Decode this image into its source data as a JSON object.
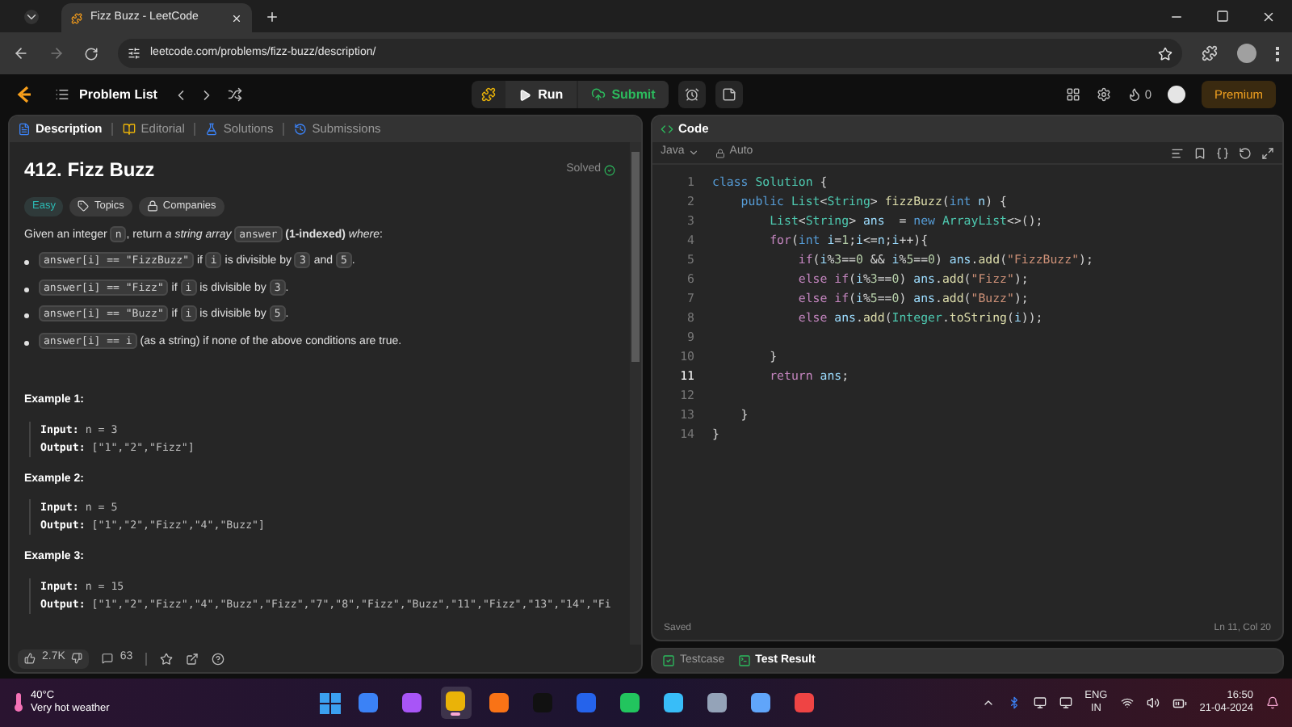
{
  "browser": {
    "tab_title": "Fizz Buzz - LeetCode",
    "url": "leetcode.com/problems/fizz-buzz/description/"
  },
  "nav": {
    "problem_list": "Problem List",
    "run": "Run",
    "submit": "Submit",
    "streak": "0",
    "premium": "Premium"
  },
  "left_tabs": [
    {
      "label": "Description",
      "selected": true
    },
    {
      "label": "Editorial",
      "selected": false
    },
    {
      "label": "Solutions",
      "selected": false
    },
    {
      "label": "Submissions",
      "selected": false
    }
  ],
  "problem": {
    "title": "412. Fizz Buzz",
    "status": "Solved",
    "tags": [
      {
        "kind": "difficulty",
        "label": "Easy"
      },
      {
        "kind": "topics",
        "label": "Topics"
      },
      {
        "kind": "companies",
        "label": "Companies"
      }
    ],
    "statement": [
      {
        "kind": "text",
        "text": "Given an integer "
      },
      {
        "kind": "code",
        "text": "n"
      },
      {
        "kind": "text",
        "text": ", return *a string array* "
      },
      {
        "kind": "code",
        "text": "answer"
      },
      {
        "kind": "text",
        "text": " **(1-indexed)** *where*:"
      }
    ],
    "bullets": [
      [
        {
          "kind": "code",
          "text": "answer[i] == \"FizzBuzz\""
        },
        {
          "kind": "text",
          "text": " if "
        },
        {
          "kind": "code",
          "text": "i"
        },
        {
          "kind": "text",
          "text": " is divisible by "
        },
        {
          "kind": "code",
          "text": "3"
        },
        {
          "kind": "text",
          "text": " and "
        },
        {
          "kind": "code",
          "text": "5"
        },
        {
          "kind": "text",
          "text": "."
        }
      ],
      [
        {
          "kind": "code",
          "text": "answer[i] == \"Fizz\""
        },
        {
          "kind": "text",
          "text": " if "
        },
        {
          "kind": "code",
          "text": "i"
        },
        {
          "kind": "text",
          "text": " is divisible by "
        },
        {
          "kind": "code",
          "text": "3"
        },
        {
          "kind": "text",
          "text": "."
        }
      ],
      [
        {
          "kind": "code",
          "text": "answer[i] == \"Buzz\""
        },
        {
          "kind": "text",
          "text": " if "
        },
        {
          "kind": "code",
          "text": "i"
        },
        {
          "kind": "text",
          "text": " is divisible by "
        },
        {
          "kind": "code",
          "text": "5"
        },
        {
          "kind": "text",
          "text": "."
        }
      ],
      [
        {
          "kind": "code",
          "text": "answer[i] == i"
        },
        {
          "kind": "text",
          "text": " (as a string) if none of the above conditions are true."
        }
      ]
    ],
    "examples": [
      {
        "title": "Example 1:",
        "input_label": "Input:",
        "input": "n = 3",
        "output_label": "Output:",
        "output": "[\"1\",\"2\",\"Fizz\"]"
      },
      {
        "title": "Example 2:",
        "input_label": "Input:",
        "input": "n = 5",
        "output_label": "Output:",
        "output": "[\"1\",\"2\",\"Fizz\",\"4\",\"Buzz\"]"
      },
      {
        "title": "Example 3:",
        "input_label": "Input:",
        "input": "n = 15",
        "output_label": "Output:",
        "output": "[\"1\",\"2\",\"Fizz\",\"4\",\"Buzz\",\"Fizz\",\"7\",\"8\",\"Fizz\",\"Buzz\",\"11\",\"Fizz\",\"13\",\"14\",\"Fi"
      }
    ],
    "likes": "2.7K",
    "comments": "63"
  },
  "editor": {
    "title": "Code",
    "language": "Java",
    "mode": "Auto",
    "lines": [
      {
        "number": "1",
        "current": false,
        "tokens": [
          {
            "kind": "kw",
            "text": "class"
          },
          {
            "kind": "type",
            "text": " Solution"
          },
          {
            "kind": "plain",
            "text": " {"
          }
        ]
      },
      {
        "number": "2",
        "current": false,
        "tokens": [
          {
            "kind": "kw",
            "text": "    public"
          },
          {
            "kind": "type",
            "text": " List"
          },
          {
            "kind": "plain",
            "text": "<"
          },
          {
            "kind": "type",
            "text": "String"
          },
          {
            "kind": "plain",
            "text": "> "
          },
          {
            "kind": "fn",
            "text": "fizzBuzz"
          },
          {
            "kind": "plain",
            "text": "("
          },
          {
            "kind": "kw",
            "text": "int"
          },
          {
            "kind": "var",
            "text": " n"
          },
          {
            "kind": "plain",
            "text": ") {"
          }
        ]
      },
      {
        "number": "3",
        "current": false,
        "tokens": [
          {
            "kind": "type",
            "text": "        List"
          },
          {
            "kind": "plain",
            "text": "<"
          },
          {
            "kind": "type",
            "text": "String"
          },
          {
            "kind": "plain",
            "text": "> "
          },
          {
            "kind": "var",
            "text": "ans"
          },
          {
            "kind": "plain",
            "text": "  = "
          },
          {
            "kind": "kw",
            "text": "new"
          },
          {
            "kind": "type",
            "text": " ArrayList"
          },
          {
            "kind": "plain",
            "text": "<>();"
          }
        ]
      },
      {
        "number": "4",
        "current": false,
        "tokens": [
          {
            "kind": "ctrl",
            "text": "        for"
          },
          {
            "kind": "plain",
            "text": "("
          },
          {
            "kind": "kw",
            "text": "int"
          },
          {
            "kind": "var",
            "text": " i"
          },
          {
            "kind": "plain",
            "text": "="
          },
          {
            "kind": "num",
            "text": "1"
          },
          {
            "kind": "plain",
            "text": ";"
          },
          {
            "kind": "var",
            "text": "i"
          },
          {
            "kind": "plain",
            "text": "<="
          },
          {
            "kind": "var",
            "text": "n"
          },
          {
            "kind": "plain",
            "text": ";"
          },
          {
            "kind": "var",
            "text": "i"
          },
          {
            "kind": "plain",
            "text": "++){"
          }
        ]
      },
      {
        "number": "5",
        "current": false,
        "tokens": [
          {
            "kind": "ctrl",
            "text": "            if"
          },
          {
            "kind": "plain",
            "text": "("
          },
          {
            "kind": "var",
            "text": "i"
          },
          {
            "kind": "plain",
            "text": "%"
          },
          {
            "kind": "num",
            "text": "3"
          },
          {
            "kind": "plain",
            "text": "=="
          },
          {
            "kind": "num",
            "text": "0"
          },
          {
            "kind": "plain",
            "text": " && "
          },
          {
            "kind": "var",
            "text": "i"
          },
          {
            "kind": "plain",
            "text": "%"
          },
          {
            "kind": "num",
            "text": "5"
          },
          {
            "kind": "plain",
            "text": "=="
          },
          {
            "kind": "num",
            "text": "0"
          },
          {
            "kind": "plain",
            "text": ") "
          },
          {
            "kind": "var",
            "text": "ans"
          },
          {
            "kind": "plain",
            "text": "."
          },
          {
            "kind": "fn",
            "text": "add"
          },
          {
            "kind": "plain",
            "text": "("
          },
          {
            "kind": "str",
            "text": "\"FizzBuzz\""
          },
          {
            "kind": "plain",
            "text": ");"
          }
        ]
      },
      {
        "number": "6",
        "current": false,
        "tokens": [
          {
            "kind": "ctrl",
            "text": "            else if"
          },
          {
            "kind": "plain",
            "text": "("
          },
          {
            "kind": "var",
            "text": "i"
          },
          {
            "kind": "plain",
            "text": "%"
          },
          {
            "kind": "num",
            "text": "3"
          },
          {
            "kind": "plain",
            "text": "=="
          },
          {
            "kind": "num",
            "text": "0"
          },
          {
            "kind": "plain",
            "text": ") "
          },
          {
            "kind": "var",
            "text": "ans"
          },
          {
            "kind": "plain",
            "text": "."
          },
          {
            "kind": "fn",
            "text": "add"
          },
          {
            "kind": "plain",
            "text": "("
          },
          {
            "kind": "str",
            "text": "\"Fizz\""
          },
          {
            "kind": "plain",
            "text": ");"
          }
        ]
      },
      {
        "number": "7",
        "current": false,
        "tokens": [
          {
            "kind": "ctrl",
            "text": "            else if"
          },
          {
            "kind": "plain",
            "text": "("
          },
          {
            "kind": "var",
            "text": "i"
          },
          {
            "kind": "plain",
            "text": "%"
          },
          {
            "kind": "num",
            "text": "5"
          },
          {
            "kind": "plain",
            "text": "=="
          },
          {
            "kind": "num",
            "text": "0"
          },
          {
            "kind": "plain",
            "text": ") "
          },
          {
            "kind": "var",
            "text": "ans"
          },
          {
            "kind": "plain",
            "text": "."
          },
          {
            "kind": "fn",
            "text": "add"
          },
          {
            "kind": "plain",
            "text": "("
          },
          {
            "kind": "str",
            "text": "\"Buzz\""
          },
          {
            "kind": "plain",
            "text": ");"
          }
        ]
      },
      {
        "number": "8",
        "current": false,
        "tokens": [
          {
            "kind": "ctrl",
            "text": "            else"
          },
          {
            "kind": "var",
            "text": " ans"
          },
          {
            "kind": "plain",
            "text": "."
          },
          {
            "kind": "fn",
            "text": "add"
          },
          {
            "kind": "plain",
            "text": "("
          },
          {
            "kind": "type",
            "text": "Integer"
          },
          {
            "kind": "plain",
            "text": "."
          },
          {
            "kind": "fn",
            "text": "toString"
          },
          {
            "kind": "plain",
            "text": "("
          },
          {
            "kind": "var",
            "text": "i"
          },
          {
            "kind": "plain",
            "text": "));"
          }
        ]
      },
      {
        "number": "9",
        "current": false
      },
      {
        "number": "10",
        "current": false,
        "tokens": [
          {
            "kind": "plain",
            "text": "        }"
          }
        ]
      },
      {
        "number": "11",
        "current": true,
        "tokens": [
          {
            "kind": "ctrl",
            "text": "        return"
          },
          {
            "kind": "var",
            "text": " ans"
          },
          {
            "kind": "plain",
            "text": ";"
          }
        ]
      },
      {
        "number": "12",
        "current": false
      },
      {
        "number": "13",
        "current": false,
        "tokens": [
          {
            "kind": "plain",
            "text": "    }"
          }
        ]
      },
      {
        "number": "14",
        "current": false,
        "tokens": [
          {
            "kind": "plain",
            "text": "}"
          }
        ]
      }
    ],
    "save_status": "Saved",
    "cursor": "Ln 11, Col 20"
  },
  "bottom_tabs": [
    {
      "label": "Testcase",
      "selected": false
    },
    {
      "label": "Test Result",
      "selected": true
    }
  ],
  "taskbar": {
    "temperature": "40°C",
    "weather": "Very hot weather",
    "lang": "ENG",
    "region": "IN",
    "time": "16:50",
    "date": "21-04-2024",
    "apps": [
      {
        "selected": false,
        "color": "#3b82f6"
      },
      {
        "selected": false,
        "color": "#a855f7"
      },
      {
        "selected": true,
        "color": "#eab308"
      },
      {
        "selected": false,
        "color": "#f97316"
      },
      {
        "selected": false,
        "color": "#111111"
      },
      {
        "selected": false,
        "color": "#2563eb"
      },
      {
        "selected": false,
        "color": "#22c55e"
      },
      {
        "selected": false,
        "color": "#38bdf8"
      },
      {
        "selected": false,
        "color": "#94a3b8"
      },
      {
        "selected": false,
        "color": "#60a5fa"
      },
      {
        "selected": false,
        "color": "#ef4444"
      }
    ]
  }
}
